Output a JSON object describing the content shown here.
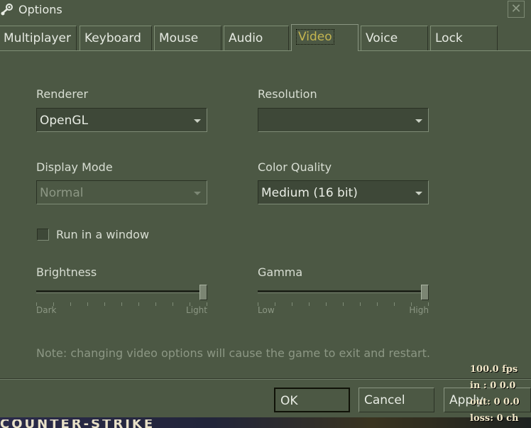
{
  "window": {
    "title": "Options",
    "close_glyph": "✕"
  },
  "tabs": [
    {
      "label": "Multiplayer",
      "active": false
    },
    {
      "label": "Keyboard",
      "active": false
    },
    {
      "label": "Mouse",
      "active": false
    },
    {
      "label": "Audio",
      "active": false
    },
    {
      "label": "Video",
      "active": true
    },
    {
      "label": "Voice",
      "active": false
    },
    {
      "label": "Lock",
      "active": false
    }
  ],
  "video": {
    "renderer": {
      "label": "Renderer",
      "value": "OpenGL"
    },
    "resolution": {
      "label": "Resolution",
      "value": ""
    },
    "display_mode": {
      "label": "Display Mode",
      "value": "Normal",
      "disabled": true
    },
    "color_quality": {
      "label": "Color Quality",
      "value": "Medium (16 bit)"
    },
    "run_in_window": {
      "label": "Run in a window",
      "checked": false
    },
    "brightness": {
      "label": "Brightness",
      "min_label": "Dark",
      "max_label": "Light",
      "value_fraction": 1.0
    },
    "gamma": {
      "label": "Gamma",
      "min_label": "Low",
      "max_label": "High",
      "value_fraction": 1.0
    },
    "note": "Note: changing video options will cause the game to exit and restart."
  },
  "buttons": {
    "ok": "OK",
    "cancel": "Cancel",
    "apply": "Apply"
  },
  "overlay": {
    "fps": "100.0 fps",
    "in": "in :  0 0.0",
    "out": "out:  0 0.0",
    "loss": "loss: 0 ch"
  },
  "game_logo_text": "COUNTER-STRIKE",
  "colors": {
    "panel": "#4c5844",
    "active_tab_text": "#c4b550",
    "dim_text": "#8c9784"
  }
}
